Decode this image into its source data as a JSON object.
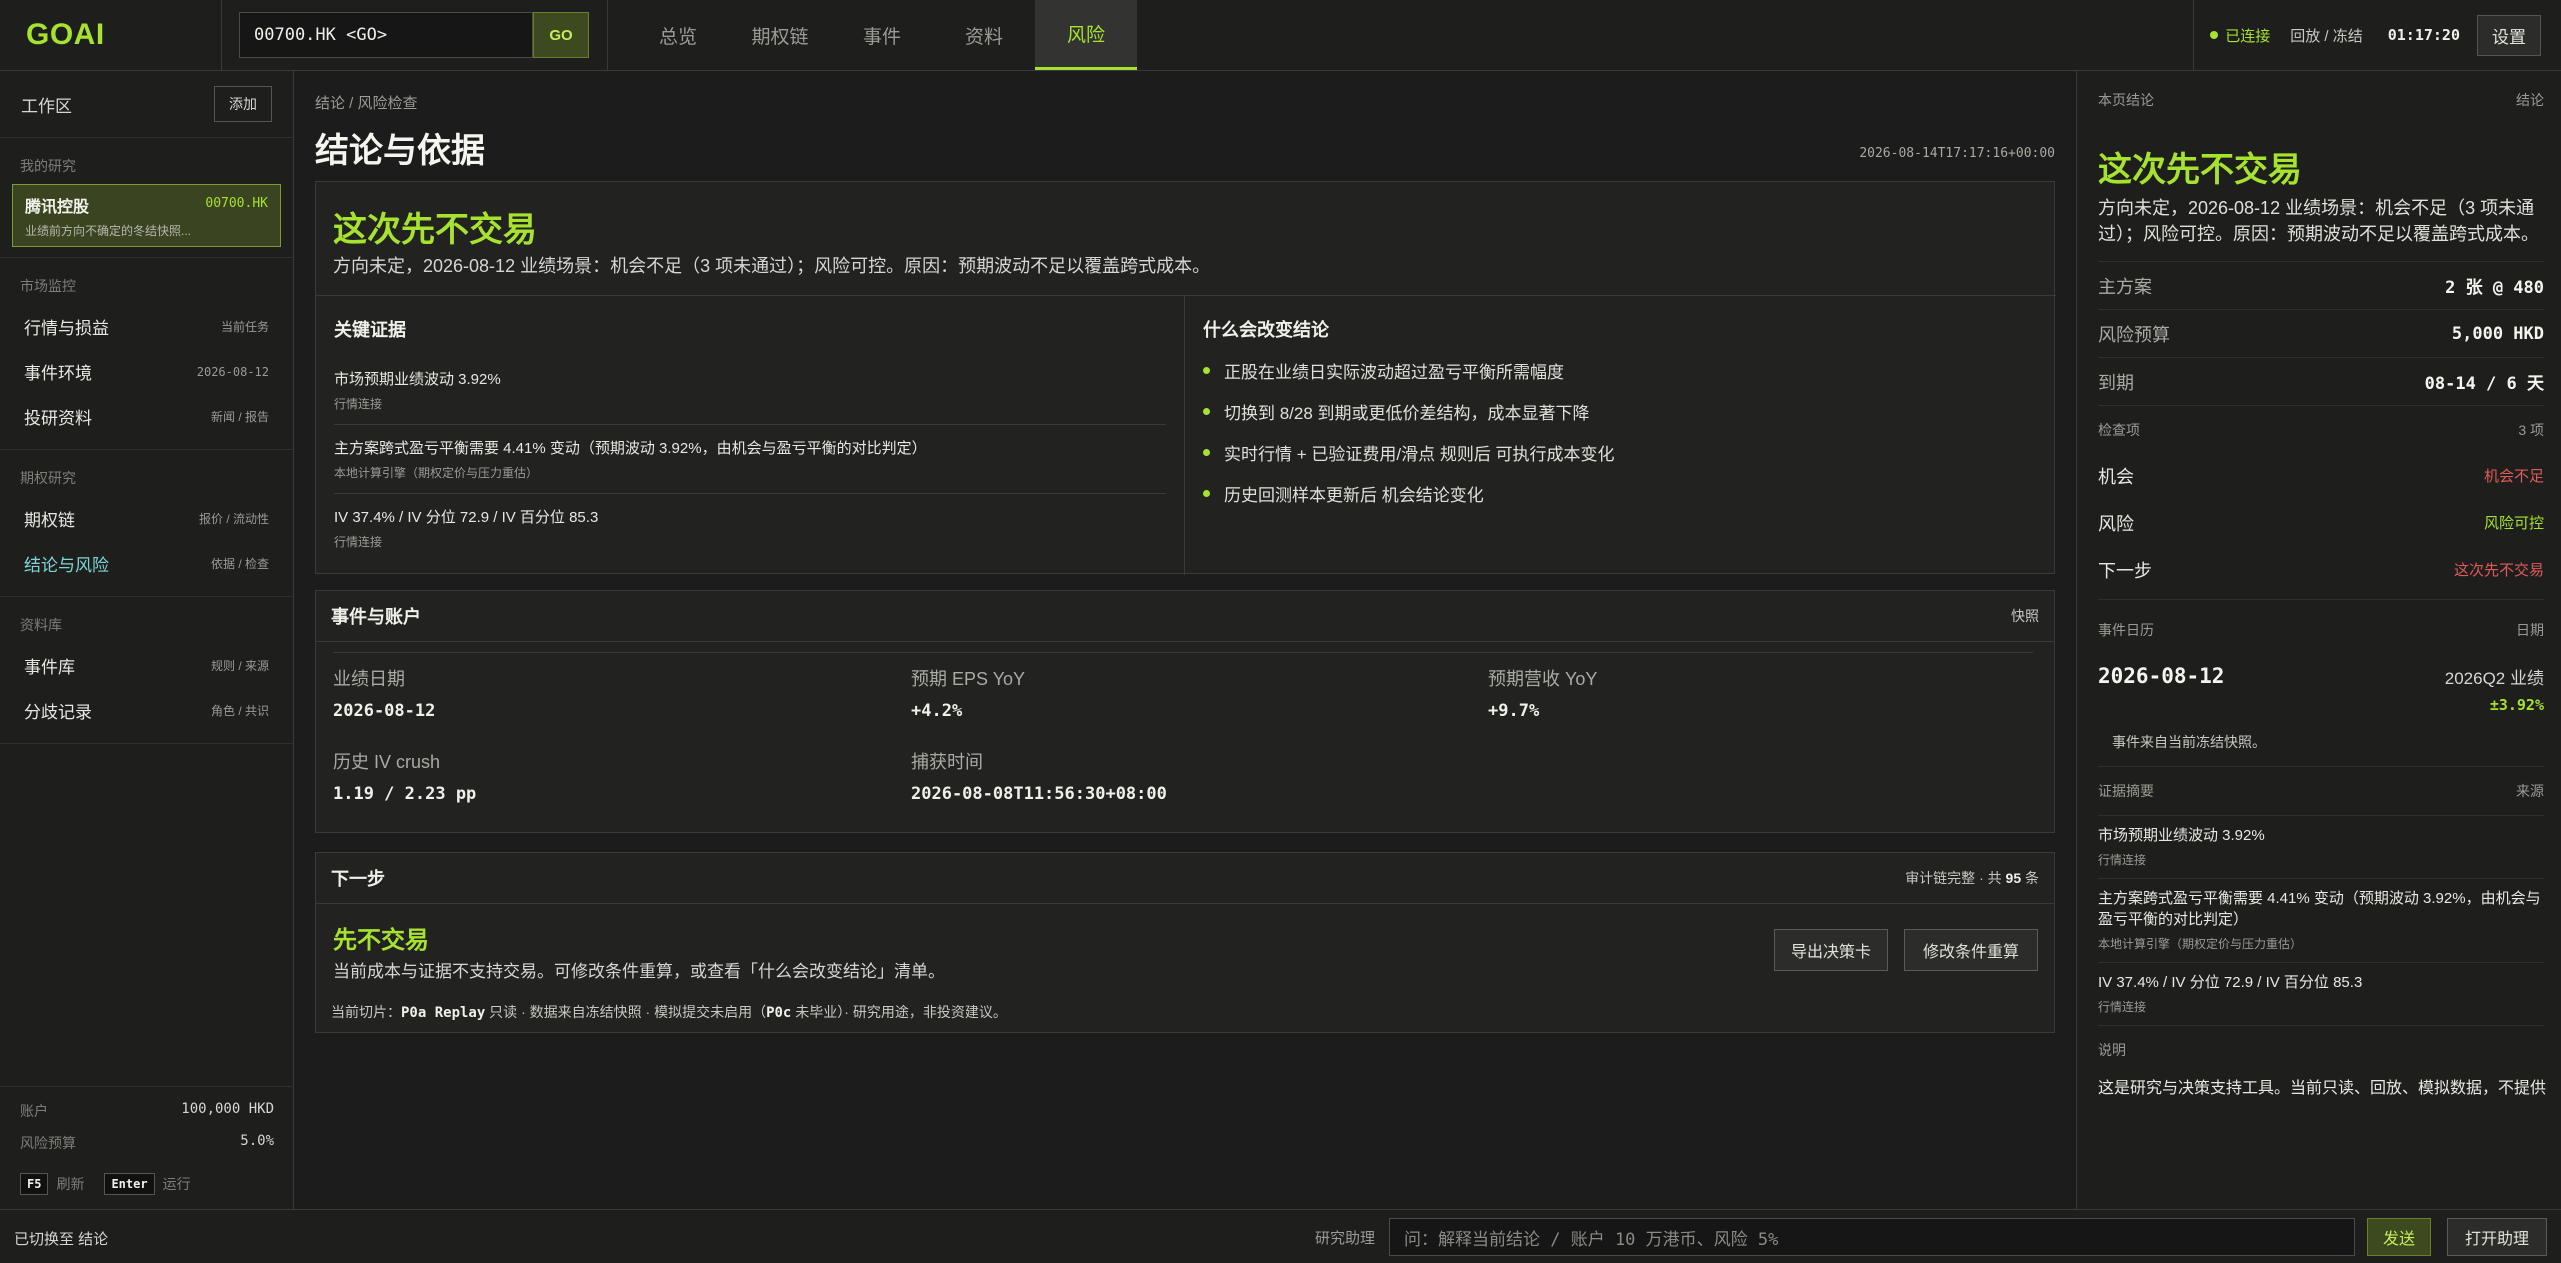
{
  "app": {
    "logo": "GOAI"
  },
  "command": {
    "value": "00700.HK <GO>",
    "go_label": "GO"
  },
  "nav": {
    "tabs": [
      "总览",
      "期权链",
      "事件",
      "资料",
      "风险"
    ],
    "active": "风险"
  },
  "status": {
    "connected": "已连接",
    "mode": "回放 / 冻结",
    "clock": "01:17:20",
    "settings": "设置"
  },
  "sidebar": {
    "workspace": "工作区",
    "add": "添加",
    "my_research": "我的研究",
    "card": {
      "name": "腾讯控股",
      "code": "00700.HK",
      "sub": "业绩前方向不确定的冬结快照..."
    },
    "market_label": "市场监控",
    "market_items": [
      {
        "label": "行情与损益",
        "right": "当前任务"
      },
      {
        "label": "事件环境",
        "right": "2026-08-12"
      },
      {
        "label": "投研资料",
        "right": "新闻 / 报告"
      }
    ],
    "option_label": "期权研究",
    "option_items": [
      {
        "label": "期权链",
        "right": "报价 / 流动性"
      },
      {
        "label": "结论与风险",
        "right": "依据 / 检查"
      }
    ],
    "library_label": "资料库",
    "library_items": [
      {
        "label": "事件库",
        "right": "规则 / 来源"
      },
      {
        "label": "分歧记录",
        "right": "角色 / 共识"
      }
    ],
    "account_label": "账户",
    "account_value": "100,000 HKD",
    "risk_label": "风险预算",
    "risk_value": "5.0%",
    "key1": "F5",
    "key1_label": "刷新",
    "key2": "Enter",
    "key2_label": "运行"
  },
  "main": {
    "breadcrumb": "结论  /  风险检查",
    "title": "结论与依据",
    "timestamp": "2026-08-14T17:17:16+00:00",
    "verdict": "这次先不交易",
    "verdict_sub": "方向未定，2026-08-12 业绩场景：机会不足（3 项未通过）；风险可控。原因：预期波动不足以覆盖跨式成本。",
    "evidence_title": "关键证据",
    "evidence": [
      {
        "text": "市场预期业绩波动 3.92%",
        "source": "行情连接"
      },
      {
        "text": "主方案跨式盈亏平衡需要 4.41% 变动（预期波动 3.92%，由机会与盈亏平衡的对比判定）",
        "source": "本地计算引擎（期权定价与压力重估）"
      },
      {
        "text": "IV 37.4% / IV 分位 72.9 / IV 百分位 85.3",
        "source": "行情连接"
      }
    ],
    "change_title": "什么会改变结论",
    "changes": [
      "正股在业绩日实际波动超过盈亏平衡所需幅度",
      "切换到 8/28 到期或更低价差结构，成本显著下降",
      "实时行情 + 已验证费用/滑点 规则后 可执行成本变化",
      "历史回测样本更新后 机会结论变化"
    ],
    "events_title": "事件与账户",
    "events_right": "快照",
    "events": [
      {
        "k": "业绩日期",
        "v": "2026-08-12"
      },
      {
        "k": "预期 EPS YoY",
        "v": "+4.2%"
      },
      {
        "k": "预期营收 YoY",
        "v": "+9.7%"
      },
      {
        "k": "历史 IV crush",
        "v": "1.19 / 2.23 pp"
      },
      {
        "k": "捕获时间",
        "v": "2026-08-08T11:56:30+08:00"
      }
    ],
    "next_title": "下一步",
    "audit_prefix": "审计链完整 · 共 ",
    "audit_count": "95",
    "audit_suffix": " 条",
    "next_action": "先不交易",
    "next_sub": "当前成本与证据不支持交易。可修改条件重算，或查看「什么会改变结论」清单。",
    "next_meta_prefix": "当前切片：",
    "next_meta_bold1": "P0a Replay",
    "next_meta_mid": " 只读 · 数据来自冻结快照 · 模拟提交未启用（",
    "next_meta_bold2": "P0c",
    "next_meta_suffix": " 未毕业）· 研究用途，非投资建议。",
    "export_btn": "导出决策卡",
    "recalc_btn": "修改条件重算"
  },
  "right": {
    "sec_label": "本页结论",
    "sec_right": "结论",
    "verdict": "这次先不交易",
    "verdict_sub": "方向未定，2026-08-12 业绩场景：机会不足（3 项未通过）；风险可控。原因：预期波动不足以覆盖跨式成本。",
    "kv": [
      {
        "k": "主方案",
        "v": "2 张 @ 480"
      },
      {
        "k": "风险预算",
        "v": "5,000 HKD"
      },
      {
        "k": "到期",
        "v": "08-14 / 6 天"
      }
    ],
    "checks_label": "检查项",
    "checks_count": "3 项",
    "checks": [
      {
        "k": "机会",
        "v": "机会不足",
        "color": "#e05a5a"
      },
      {
        "k": "风险",
        "v": "风险可控",
        "color": "#a6e22e"
      },
      {
        "k": "下一步",
        "v": "这次先不交易",
        "color": "#e05a5a"
      }
    ],
    "cal_label": "事件日历",
    "cal_right": "日期",
    "cal_date": "2026-08-12",
    "cal_event": "2026Q2 业绩",
    "cal_move": "±3.92%",
    "cal_note": "事件来自当前冻结快照。",
    "ev_label": "证据摘要",
    "ev_right": "来源",
    "evidence": [
      {
        "text": "市场预期业绩波动 3.92%",
        "source": "行情连接"
      },
      {
        "text": "主方案跨式盈亏平衡需要 4.41% 变动（预期波动 3.92%，由机会与盈亏平衡的对比判定）",
        "source": "本地计算引擎（期权定价与压力重估）"
      },
      {
        "text": "IV 37.4% / IV 分位 72.9 / IV 百分位 85.3",
        "source": "行情连接"
      }
    ],
    "note_label": "说明",
    "note_text": "这是研究与决策支持工具。当前只读、回放、模拟数据，不提供"
  },
  "bottom": {
    "left": "已切换至 结论",
    "label": "研究助理",
    "placeholder": "问：解释当前结论 / 账户 10 万港币、风险 5%",
    "send": "发送",
    "open": "打开助理"
  },
  "colors": {
    "accent": "#a6e22e",
    "negative": "#e05a5a",
    "bg": "#1b1c1b"
  }
}
